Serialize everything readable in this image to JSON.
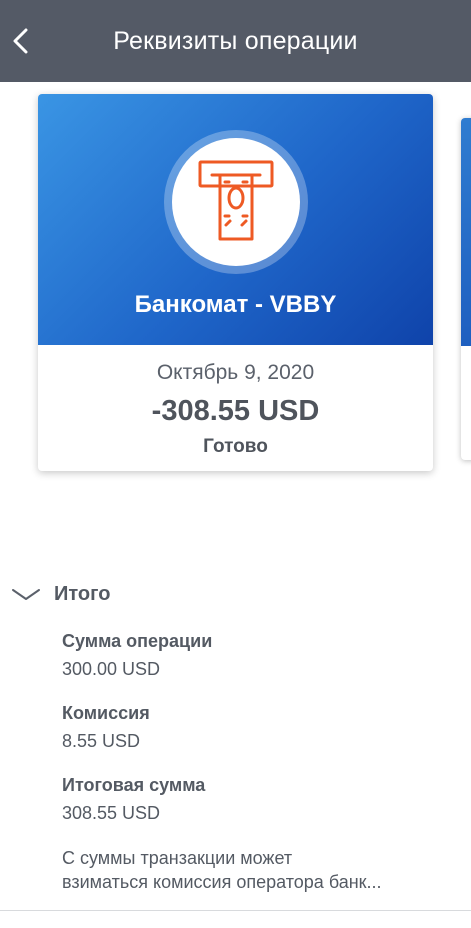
{
  "header": {
    "title": "Реквизиты операции",
    "back_icon": "chevron-left-icon"
  },
  "card": {
    "icon": "atm-cash-icon",
    "icon_color": "#ee5a24",
    "merchant": "Банкомат - VBBY",
    "date": "Октябрь 9, 2020",
    "amount": "-308.55 USD",
    "status": "Готово"
  },
  "totals": {
    "title": "Итого",
    "toggle_icon": "chevron-down-icon",
    "items": [
      {
        "label": "Сумма операции",
        "value": "300.00 USD"
      },
      {
        "label": "Комиссия",
        "value": "8.55 USD"
      },
      {
        "label": "Итоговая сумма",
        "value": "308.55 USD"
      }
    ],
    "note_line1": "С суммы транзакции может",
    "note_line2": "взиматься комиссия оператора банк..."
  },
  "colors": {
    "topbar": "#545a66",
    "card_gradient_start": "#3a95e4",
    "card_gradient_end": "#0f43aa",
    "text": "#545a63"
  }
}
